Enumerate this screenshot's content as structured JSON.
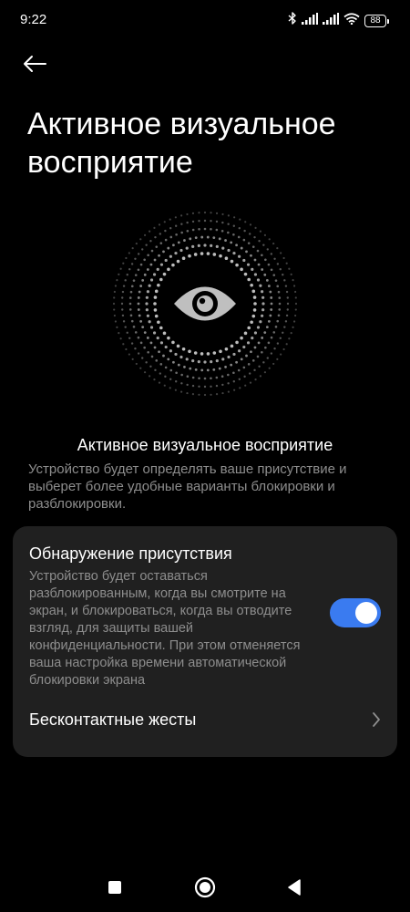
{
  "status_bar": {
    "time": "9:22",
    "battery": "88",
    "icons": [
      "bluetooth-icon",
      "signal-icon",
      "signal-icon",
      "wifi-icon",
      "battery-icon"
    ]
  },
  "header": {
    "back_icon": "arrow-left-icon",
    "title": "Активное визуальное восприятие"
  },
  "hero": {
    "icon": "eye-icon"
  },
  "feature": {
    "title": "Активное визуальное восприятие",
    "description": "Устройство будет определять ваше присутствие и выберет более удобные варианты блокировки и разблокировки."
  },
  "settings": {
    "presence": {
      "title": "Обнаружение присутствия",
      "description": "Устройство будет оставаться разблокированным, когда вы смотрите на экран, и блокироваться, когда вы отводите взгляд, для защиты вашей конфиденциальности. При этом отменяется ваша настройка времени автоматической блокировки экрана",
      "enabled": true
    },
    "gestures": {
      "label": "Бесконтактные жесты",
      "icon": "chevron-right-icon"
    }
  },
  "nav_bar": {
    "icons": [
      "recents-square-icon",
      "home-circle-icon",
      "back-triangle-icon"
    ]
  },
  "colors": {
    "background": "#000000",
    "card": "#202020",
    "accent": "#3a7bf0",
    "secondary_text": "#8d8d8d"
  }
}
